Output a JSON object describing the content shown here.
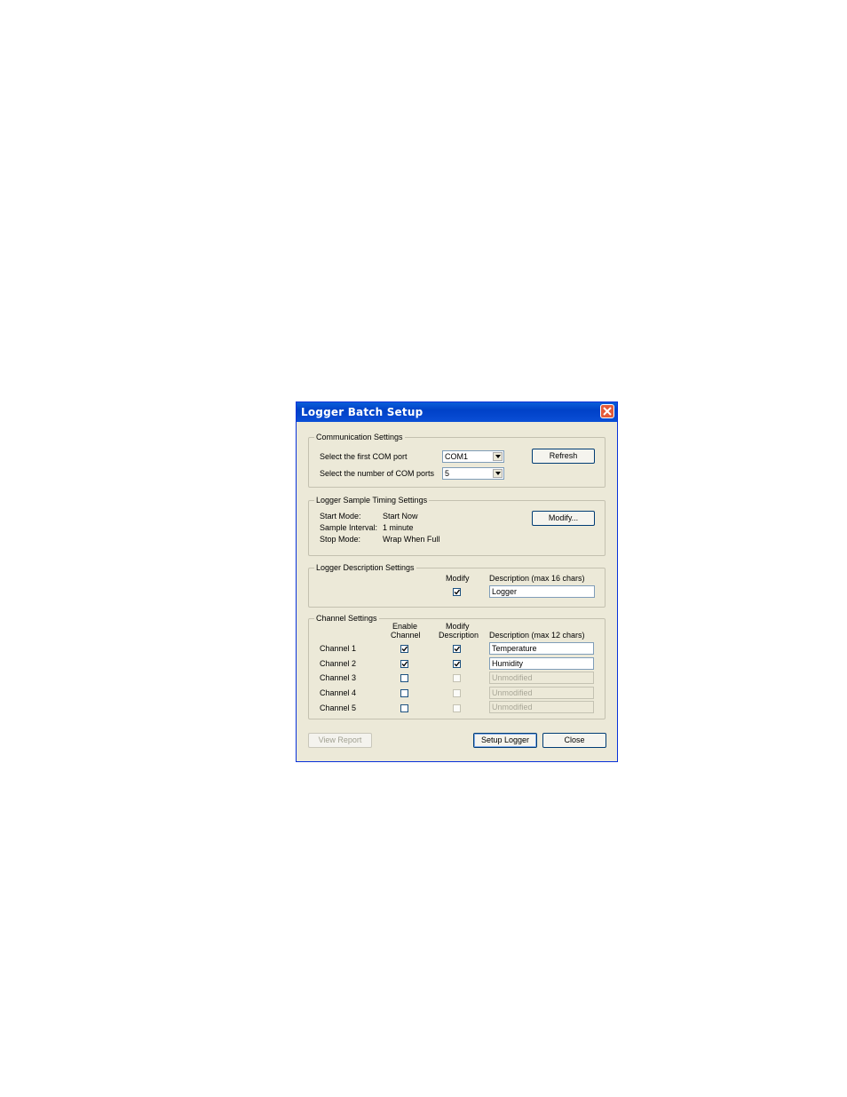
{
  "window": {
    "title": "Logger Batch Setup"
  },
  "communication": {
    "legend": "Communication Settings",
    "first_port_label": "Select the first COM port",
    "first_port_value": "COM1",
    "num_ports_label": "Select the number of COM ports",
    "num_ports_value": "5",
    "refresh_label": "Refresh"
  },
  "timing": {
    "legend": "Logger Sample Timing Settings",
    "start_label": "Start Mode:",
    "start_value": "Start Now",
    "interval_label": "Sample Interval:",
    "interval_value": "1 minute",
    "stop_label": "Stop Mode:",
    "stop_value": "Wrap When Full",
    "modify_label": "Modify..."
  },
  "description": {
    "legend": "Logger Description Settings",
    "modify_header": "Modify",
    "desc_header": "Description (max 16 chars)",
    "modify_checked": true,
    "value": "Logger"
  },
  "channels": {
    "legend": "Channel Settings",
    "enable_header_1": "Enable",
    "enable_header_2": "Channel",
    "modify_header_1": "Modify",
    "modify_header_2": "Description",
    "desc_header": "Description (max 12 chars)",
    "rows": [
      {
        "name": "Channel 1",
        "enabled": true,
        "modify": true,
        "description": "Temperature",
        "disabled": false
      },
      {
        "name": "Channel 2",
        "enabled": true,
        "modify": true,
        "description": "Humidity",
        "disabled": false
      },
      {
        "name": "Channel 3",
        "enabled": false,
        "modify": false,
        "description": "Unmodified",
        "disabled": true
      },
      {
        "name": "Channel 4",
        "enabled": false,
        "modify": false,
        "description": "Unmodified",
        "disabled": true
      },
      {
        "name": "Channel 5",
        "enabled": false,
        "modify": false,
        "description": "Unmodified",
        "disabled": true
      }
    ]
  },
  "buttons": {
    "view_report": "View Report",
    "setup_logger": "Setup Logger",
    "close": "Close"
  }
}
